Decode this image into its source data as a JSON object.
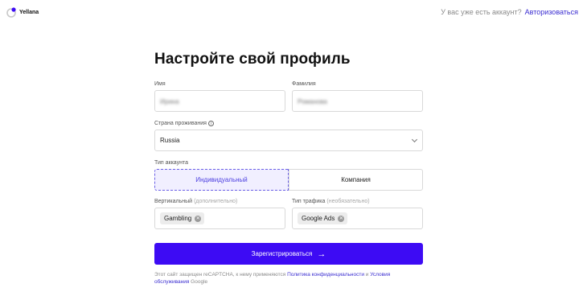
{
  "header": {
    "brand": "Yellana",
    "login_question": "У вас уже есть аккаунт?",
    "login_link": "Авторизоваться"
  },
  "form": {
    "title": "Настройте свой профиль",
    "first_name": {
      "label": "Имя",
      "value": "Ирина"
    },
    "last_name": {
      "label": "Фамилия",
      "value": "Романова"
    },
    "country": {
      "label": "Страна проживания",
      "value": "Russia"
    },
    "account_type": {
      "label": "Тип аккаунта",
      "options": [
        "Индивидуальный",
        "Компания"
      ],
      "selected": "Индивидуальный"
    },
    "vertical": {
      "label": "Вертикальный",
      "hint": "(дополнительно)",
      "chip": "Gambling"
    },
    "traffic": {
      "label": "Тип трафика",
      "hint": "(необязательно)",
      "chip": "Google Ads"
    },
    "submit_label": "Зарегистрироваться",
    "legal": {
      "prefix": "Этот сайт защищен reCAPTCHA, к нему применяются",
      "privacy": "Политика конфиденциальности",
      "and": "и",
      "terms": "Условия обслуживания",
      "suffix": "Google"
    }
  },
  "colors": {
    "accent": "#3d0bf4",
    "link": "#3b2ed1",
    "selected_bg": "#f1efff"
  },
  "icons": [
    "logo-icon",
    "info-icon",
    "chevron-down-icon",
    "remove-chip-icon",
    "arrow-right-icon"
  ]
}
